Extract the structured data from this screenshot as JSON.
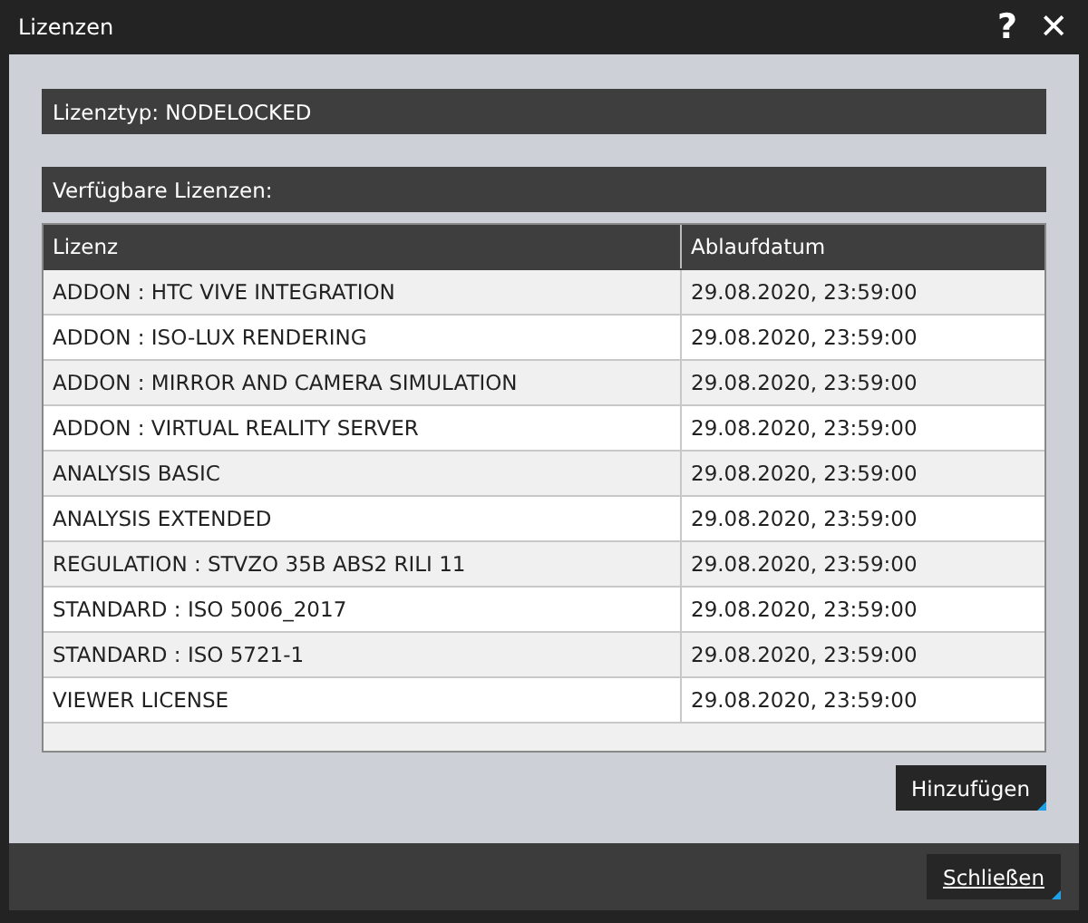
{
  "window": {
    "title": "Lizenzen",
    "help": "?",
    "close": "✕"
  },
  "license_type": "Lizenztyp: NODELOCKED",
  "available_heading": "Verfügbare Lizenzen:",
  "table": {
    "columns": [
      "Lizenz",
      "Ablaufdatum"
    ],
    "rows": [
      [
        "ADDON : HTC VIVE INTEGRATION",
        "29.08.2020, 23:59:00"
      ],
      [
        "ADDON : ISO-LUX RENDERING",
        "29.08.2020, 23:59:00"
      ],
      [
        "ADDON : MIRROR AND CAMERA SIMULATION",
        "29.08.2020, 23:59:00"
      ],
      [
        "ADDON : VIRTUAL REALITY SERVER",
        "29.08.2020, 23:59:00"
      ],
      [
        "ANALYSIS BASIC",
        "29.08.2020, 23:59:00"
      ],
      [
        "ANALYSIS EXTENDED",
        "29.08.2020, 23:59:00"
      ],
      [
        "REGULATION : STVZO 35B ABS2 RILI 11",
        "29.08.2020, 23:59:00"
      ],
      [
        "STANDARD : ISO 5006_2017",
        "29.08.2020, 23:59:00"
      ],
      [
        "STANDARD : ISO 5721-1",
        "29.08.2020, 23:59:00"
      ],
      [
        "VIEWER LICENSE",
        "29.08.2020, 23:59:00"
      ]
    ]
  },
  "add_button": "Hinzufügen",
  "close_button": "Schließen"
}
